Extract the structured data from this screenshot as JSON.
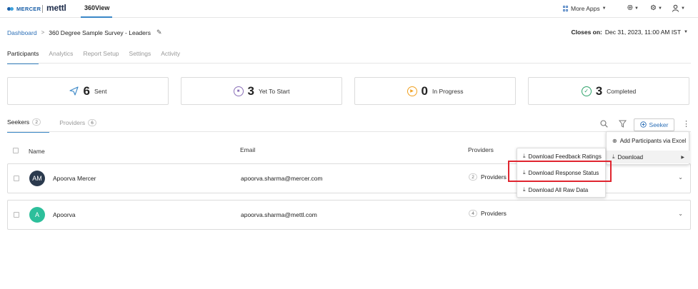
{
  "topbar": {
    "brand_mercer": "MERCER",
    "brand_mettl": "mettl",
    "app_name": "360View",
    "more_apps": "More Apps"
  },
  "breadcrumb": {
    "dashboard": "Dashboard",
    "separator": ">",
    "survey_title": "360 Degree Sample Survey - Leaders"
  },
  "closes": {
    "label": "Closes on:",
    "value": "Dec 31, 2023, 11:00 AM IST"
  },
  "tabs": [
    "Participants",
    "Analytics",
    "Report Setup",
    "Settings",
    "Activity"
  ],
  "stats": [
    {
      "count": "6",
      "label": "Sent",
      "icon": "send-icon",
      "color": "#3a87c7"
    },
    {
      "count": "3",
      "label": "Yet To Start",
      "icon": "pause-icon",
      "color": "#8a6fb8"
    },
    {
      "count": "0",
      "label": "In Progress",
      "icon": "play-icon",
      "color": "#f0a020"
    },
    {
      "count": "3",
      "label": "Completed",
      "icon": "check-icon",
      "color": "#2fa36b"
    }
  ],
  "subtabs": [
    {
      "label": "Seekers",
      "count": "2"
    },
    {
      "label": "Providers",
      "count": "6"
    }
  ],
  "seeker_button": "Seeker",
  "table": {
    "headers": {
      "name": "Name",
      "email": "Email",
      "providers": "Providers"
    },
    "rows": [
      {
        "initials": "AM",
        "avatar_color": "#2b3a4e",
        "name": "Apoorva Mercer",
        "email": "apoorva.sharma@mercer.com",
        "provider_count": "2",
        "provider_label": "Providers"
      },
      {
        "initials": "A",
        "avatar_color": "#2dbf9b",
        "name": "Apoorva",
        "email": "apoorva.sharma@mettl.com",
        "provider_count": "4",
        "provider_label": "Providers"
      }
    ]
  },
  "menu": {
    "add_via_excel": "Add Participants via Excel",
    "download": "Download",
    "download_feedback": "Download Feedback Ratings",
    "download_response": "Download Response Status",
    "download_raw": "Download All Raw Data"
  },
  "colors": {
    "accent": "#3a87c7",
    "link": "#2c6fb7",
    "highlight": "#e0252f"
  }
}
